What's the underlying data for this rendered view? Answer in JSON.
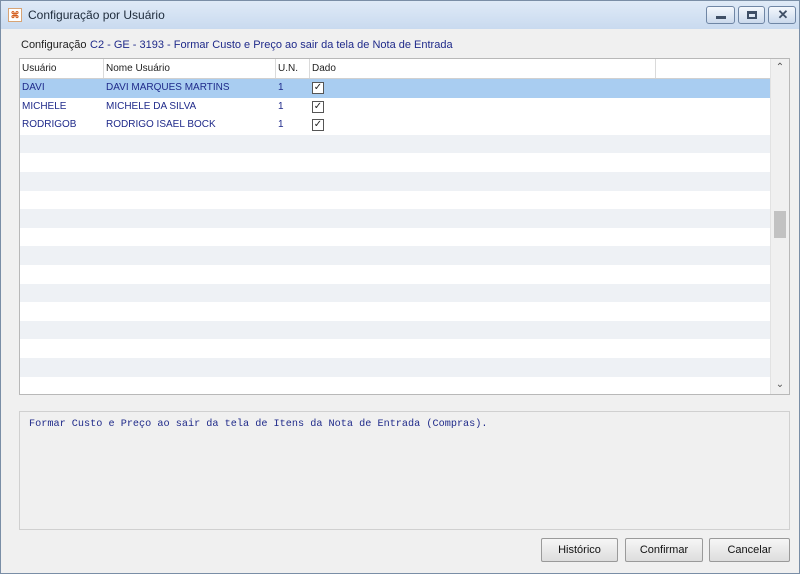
{
  "window": {
    "title": "Configuração por Usuário",
    "icon": "app-icon",
    "controls": [
      "minimize-icon",
      "maximize-icon",
      "close-icon"
    ]
  },
  "config": {
    "label": "Configuração",
    "value": "C2 - GE - 3193 - Formar Custo e Preço ao sair da tela de Nota de Entrada"
  },
  "grid": {
    "columns": [
      "Usuário",
      "Nome Usuário",
      "U.N.",
      "Dado"
    ],
    "rows": [
      {
        "usuario": "DAVI",
        "nome": "DAVI MARQUES MARTINS",
        "un": "1",
        "dado": true,
        "selected": true
      },
      {
        "usuario": "MICHELE",
        "nome": "MICHELE DA SILVA",
        "un": "1",
        "dado": true
      },
      {
        "usuario": "RODRIGOB",
        "nome": "RODRIGO ISAEL BOCK",
        "un": "1",
        "dado": true
      }
    ]
  },
  "description": "Formar Custo e Preço ao sair da tela de Itens da Nota de Entrada (Compras).",
  "buttons": {
    "historico": "Histórico",
    "confirmar": "Confirmar",
    "cancelar": "Cancelar"
  },
  "colors": {
    "selected_row": "#a9cdf1",
    "text_blue": "#1f2a8a",
    "stripe": "#eef1f5"
  }
}
